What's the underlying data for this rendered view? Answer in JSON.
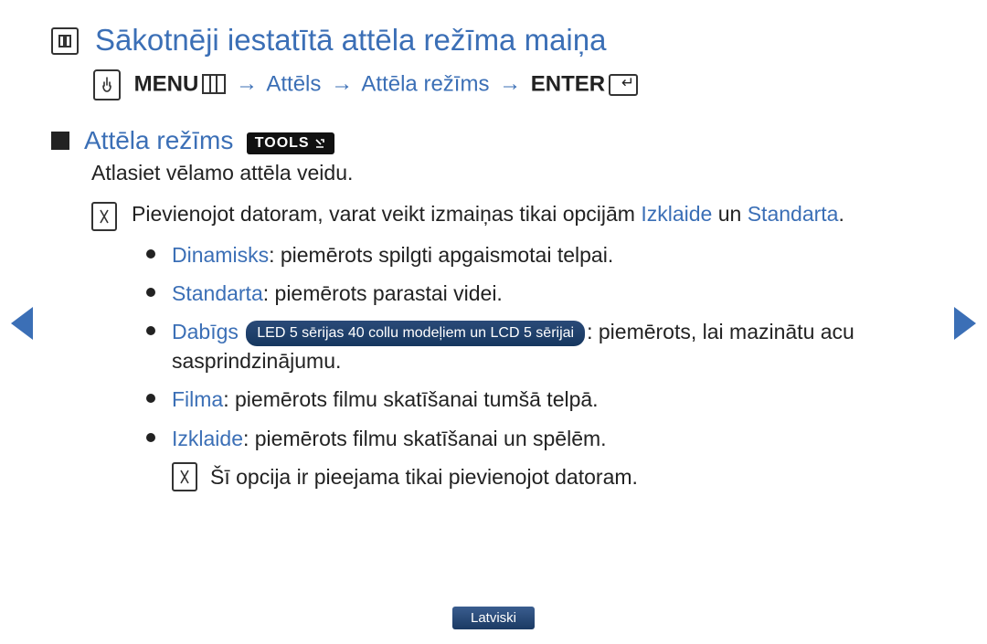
{
  "title": "Sākotnēji iestatītā attēla režīma maiņa",
  "breadcrumb": {
    "menu": "MENU",
    "step1": "Attēls",
    "step2": "Attēla režīms",
    "enter": "ENTER"
  },
  "section": {
    "heading": "Attēla režīms",
    "tools_label": "TOOLS",
    "description": "Atlasiet vēlamo attēla veidu."
  },
  "note1": {
    "prefix": "Pievienojot datoram, varat veikt izmaiņas tikai opcijām ",
    "opt1": "Izklaide",
    "mid": " un ",
    "opt2": "Standarta",
    "suffix": "."
  },
  "modes": [
    {
      "name": "Dinamisks",
      "text": ": piemērots spilgti apgaismotai telpai."
    },
    {
      "name": "Standarta",
      "text": ": piemērots parastai videi."
    },
    {
      "name": "Dabīgs",
      "badge": "LED 5 sērijas 40 collu modeļiem un LCD 5 sērijai",
      "text": ": piemērots, lai mazinātu acu sasprindzinājumu."
    },
    {
      "name": "Filma",
      "text": ": piemērots filmu skatīšanai tumšā telpā."
    },
    {
      "name": "Izklaide",
      "text": ": piemērots filmu skatīšanai un spēlēm."
    }
  ],
  "note2": "Šī opcija ir pieejama tikai pievienojot datoram.",
  "language": "Latviski"
}
